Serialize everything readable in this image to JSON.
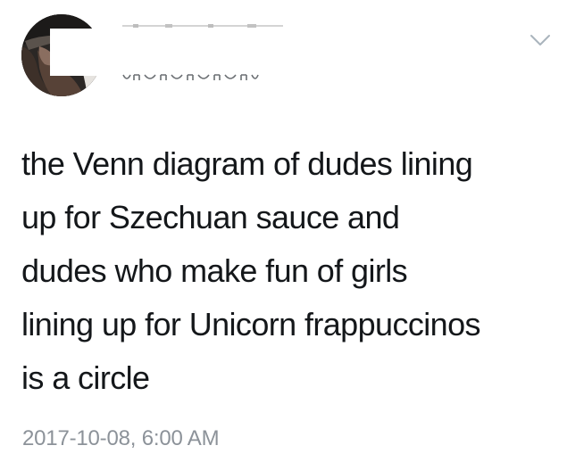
{
  "tweet": {
    "text": "the Venn diagram of dudes lining\nup for Szechuan sauce and\ndudes who make fun of girls\nlining up for Unicorn frappuccinos\nis a circle",
    "timestamp": "2017-10-08, 6:00 AM",
    "more_icon": "chevron-down-icon",
    "colors": {
      "text": "#14171a",
      "timestamp": "#8c9299",
      "chevron": "#aab4bd"
    }
  }
}
